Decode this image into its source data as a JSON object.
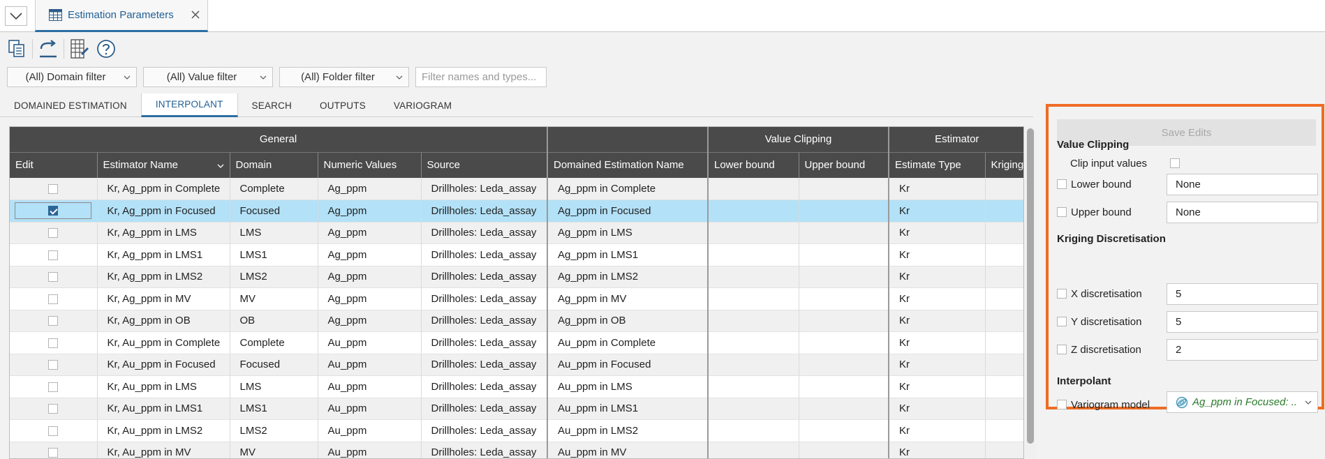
{
  "tab": {
    "title": "Estimation Parameters"
  },
  "filters": {
    "domain": "(All) Domain filter",
    "value": "(All) Value filter",
    "folder": "(All) Folder filter",
    "search_placeholder": "Filter names and types..."
  },
  "subtabs": [
    "DOMAINED ESTIMATION",
    "INTERPOLANT",
    "SEARCH",
    "OUTPUTS",
    "VARIOGRAM"
  ],
  "grid": {
    "groups": {
      "general": "General",
      "blank": "",
      "value_clipping": "Value Clipping",
      "estimator": "Estimator"
    },
    "columns": [
      "Edit",
      "Estimator Name",
      "Domain",
      "Numeric Values",
      "Source",
      "Domained Estimation Name",
      "Lower bound",
      "Upper bound",
      "Estimate Type",
      "Kriging"
    ],
    "rows": [
      {
        "name": "Kr, Ag_ppm in Complete",
        "domain": "Complete",
        "values": "Ag_ppm",
        "source": "Drillholes: Leda_assay",
        "de_name": "Ag_ppm in Complete",
        "lower": "",
        "upper": "",
        "type": "Kr",
        "checked": false
      },
      {
        "name": "Kr, Ag_ppm in Focused",
        "domain": "Focused",
        "values": "Ag_ppm",
        "source": "Drillholes: Leda_assay",
        "de_name": "Ag_ppm in Focused",
        "lower": "",
        "upper": "",
        "type": "Kr",
        "checked": true
      },
      {
        "name": "Kr, Ag_ppm in LMS",
        "domain": "LMS",
        "values": "Ag_ppm",
        "source": "Drillholes: Leda_assay",
        "de_name": "Ag_ppm in LMS",
        "lower": "",
        "upper": "",
        "type": "Kr",
        "checked": false
      },
      {
        "name": "Kr, Ag_ppm in LMS1",
        "domain": "LMS1",
        "values": "Ag_ppm",
        "source": "Drillholes: Leda_assay",
        "de_name": "Ag_ppm in LMS1",
        "lower": "",
        "upper": "",
        "type": "Kr",
        "checked": false
      },
      {
        "name": "Kr, Ag_ppm in LMS2",
        "domain": "LMS2",
        "values": "Ag_ppm",
        "source": "Drillholes: Leda_assay",
        "de_name": "Ag_ppm in LMS2",
        "lower": "",
        "upper": "",
        "type": "Kr",
        "checked": false
      },
      {
        "name": "Kr, Ag_ppm in MV",
        "domain": "MV",
        "values": "Ag_ppm",
        "source": "Drillholes: Leda_assay",
        "de_name": "Ag_ppm in MV",
        "lower": "",
        "upper": "",
        "type": "Kr",
        "checked": false
      },
      {
        "name": "Kr, Ag_ppm in OB",
        "domain": "OB",
        "values": "Ag_ppm",
        "source": "Drillholes: Leda_assay",
        "de_name": "Ag_ppm in OB",
        "lower": "",
        "upper": "",
        "type": "Kr",
        "checked": false
      },
      {
        "name": "Kr, Au_ppm in Complete",
        "domain": "Complete",
        "values": "Au_ppm",
        "source": "Drillholes: Leda_assay",
        "de_name": "Au_ppm in Complete",
        "lower": "",
        "upper": "",
        "type": "Kr",
        "checked": false
      },
      {
        "name": "Kr, Au_ppm in Focused",
        "domain": "Focused",
        "values": "Au_ppm",
        "source": "Drillholes: Leda_assay",
        "de_name": "Au_ppm in Focused",
        "lower": "",
        "upper": "",
        "type": "Kr",
        "checked": false
      },
      {
        "name": "Kr, Au_ppm in LMS",
        "domain": "LMS",
        "values": "Au_ppm",
        "source": "Drillholes: Leda_assay",
        "de_name": "Au_ppm in LMS",
        "lower": "",
        "upper": "",
        "type": "Kr",
        "checked": false
      },
      {
        "name": "Kr, Au_ppm in LMS1",
        "domain": "LMS1",
        "values": "Au_ppm",
        "source": "Drillholes: Leda_assay",
        "de_name": "Au_ppm in LMS1",
        "lower": "",
        "upper": "",
        "type": "Kr",
        "checked": false
      },
      {
        "name": "Kr, Au_ppm in LMS2",
        "domain": "LMS2",
        "values": "Au_ppm",
        "source": "Drillholes: Leda_assay",
        "de_name": "Au_ppm in LMS2",
        "lower": "",
        "upper": "",
        "type": "Kr",
        "checked": false
      },
      {
        "name": "Kr, Au_ppm in MV",
        "domain": "MV",
        "values": "Au_ppm",
        "source": "Drillholes: Leda_assay",
        "de_name": "Au_ppm in MV",
        "lower": "",
        "upper": "",
        "type": "Kr",
        "checked": false
      }
    ]
  },
  "panel": {
    "save_label": "Save Edits",
    "value_clipping": {
      "heading": "Value Clipping",
      "clip_label": "Clip input values",
      "lower_label": "Lower bound",
      "lower_value": "None",
      "upper_label": "Upper bound",
      "upper_value": "None"
    },
    "kriging": {
      "heading": "Kriging Discretisation",
      "x_label": "X discretisation",
      "x_value": "5",
      "y_label": "Y discretisation",
      "y_value": "5",
      "z_label": "Z discretisation",
      "z_value": "2"
    },
    "interpolant": {
      "heading": "Interpolant",
      "variogram_label": "Variogram model",
      "variogram_value": "Ag_ppm in Focused: ..."
    }
  },
  "colors": {
    "accent": "#2c6ea3",
    "highlight": "#ef6c24",
    "selected_row": "#b3e1f7",
    "header": "#4a4a4a"
  },
  "icons": [
    "chevron-down-icon",
    "table-icon",
    "close-icon",
    "copy-icon",
    "export-icon",
    "grid-columns-icon",
    "help-icon",
    "variogram-icon"
  ]
}
